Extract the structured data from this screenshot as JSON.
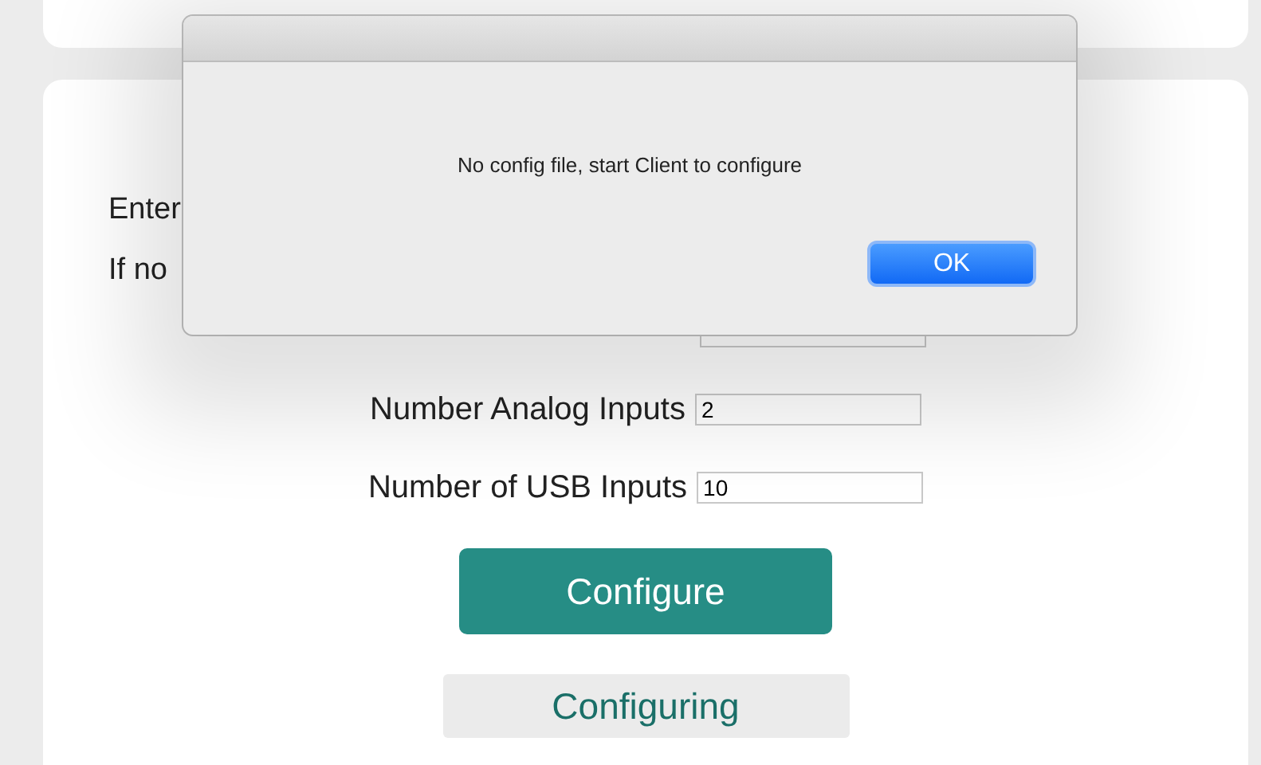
{
  "page": {
    "intro_lines": [
      "Enter",
      "If no"
    ],
    "fields": [
      {
        "label": "Number Analog Inputs",
        "value": "2"
      },
      {
        "label": "Number of USB Inputs",
        "value": "10"
      }
    ],
    "configure_button": "Configure",
    "status_button": "Configuring"
  },
  "dialog": {
    "message": "No config file, start Client to configure",
    "ok_button": "OK"
  }
}
